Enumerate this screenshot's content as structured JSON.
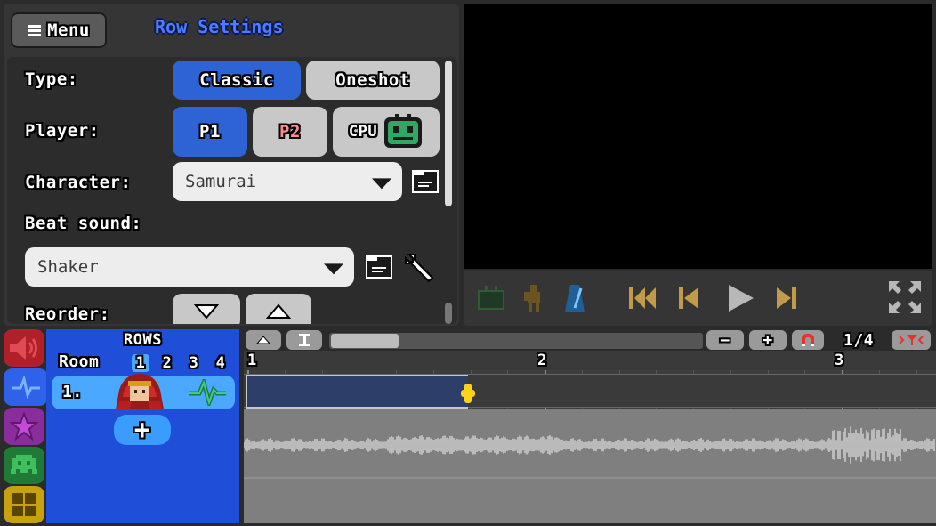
{
  "settings": {
    "menu_label": "Menu",
    "title": "Row Settings",
    "type_label": "Type:",
    "type_options": [
      "Classic",
      "Oneshot"
    ],
    "type_selected": "Classic",
    "player_label": "Player:",
    "player_options": [
      "P1",
      "P2",
      "CPU"
    ],
    "player_selected": "P1",
    "character_label": "Character:",
    "character_value": "Samurai",
    "beat_sound_label": "Beat sound:",
    "beat_sound_value": "Shaker",
    "reorder_label": "Reorder:"
  },
  "colors": {
    "accent_blue": "#2e63d6",
    "beat_marker": "#ffd21a",
    "room_number_active": "#4aa8ff",
    "p2_text": "#ff8a8a",
    "cpu_bot": "#2fa862",
    "snap_magnet": "#e8322b"
  },
  "transport": {
    "icons": [
      "tv-icon",
      "character-icon",
      "metronome-icon",
      "skip-to-start-icon",
      "previous-icon",
      "play-icon",
      "next-icon",
      "fullscreen-icon"
    ]
  },
  "tabs": [
    "sound-tab",
    "rows-tab",
    "actions-tab",
    "sprites-tab",
    "rooms-tab"
  ],
  "rows_panel": {
    "title": "ROWS",
    "room_label": "Room",
    "rooms": [
      "1",
      "2",
      "3",
      "4"
    ],
    "active_room": "1",
    "row_index": "1.",
    "add_label": "+"
  },
  "timeline_toolbar": {
    "zoom_out": "−",
    "zoom_in": "+",
    "snap_value": "1/4"
  },
  "ruler": {
    "bars": [
      "1",
      "2",
      "3"
    ]
  }
}
